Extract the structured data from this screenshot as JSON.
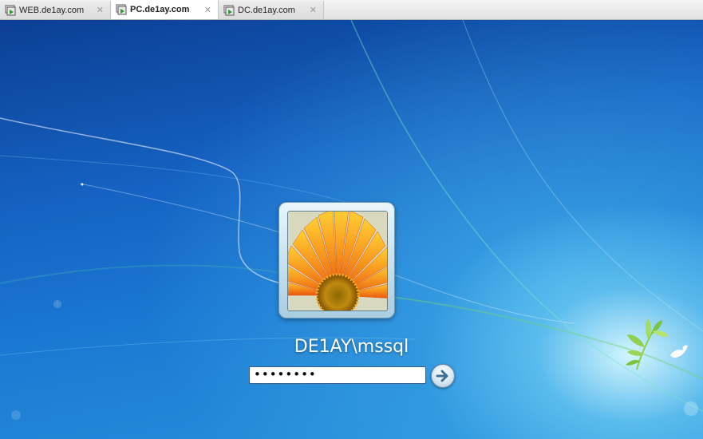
{
  "tabs": [
    {
      "label": "WEB.de1ay.com",
      "active": false,
      "close": "✕"
    },
    {
      "label": "PC.de1ay.com",
      "active": true,
      "close": "✕"
    },
    {
      "label": "DC.de1ay.com",
      "active": false,
      "close": "✕"
    }
  ],
  "icons": {
    "tab": "vm-console-icon",
    "tab_close": "close-icon",
    "submit": "arrow-right-icon",
    "user_picture": "flower-icon",
    "logo": "bird-branch-icon"
  },
  "logon": {
    "username": "DE1AY\\mssql",
    "password_masked": "••••••••"
  },
  "colors": {
    "desktop_blue": "#1562c2",
    "tile_frame": "#a9cde0",
    "flower_orange": "#f7941d"
  }
}
